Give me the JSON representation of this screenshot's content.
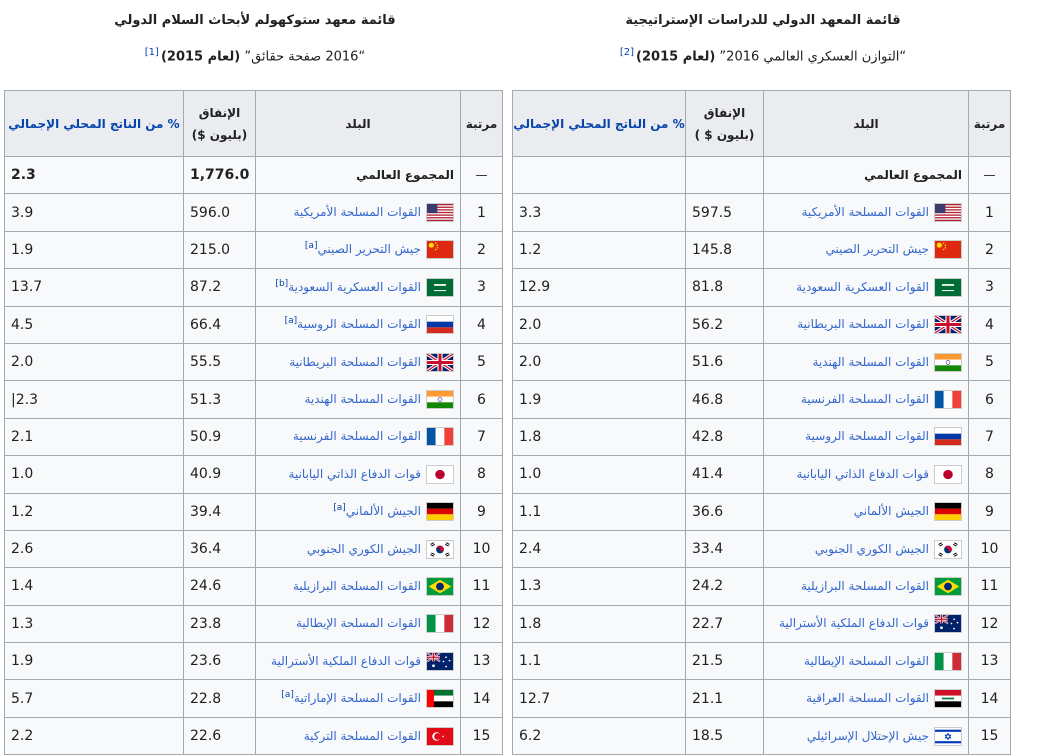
{
  "left": {
    "caption_title": "قائمة معهد ستوكهولم لأبحاث السلام الدولي",
    "caption_source": "“2016 صفحة حقائق”",
    "caption_year": "(لعام 2015)",
    "caption_ref": "[1]",
    "headers": {
      "rank": "مرتبة",
      "country": "البلد",
      "spend_1": "الإنفاق",
      "spend_2": "(بليون $)",
      "gdp": "% من الناتج المحلي الإجمالي"
    },
    "world": {
      "rank": "—",
      "country": "المجموع العالمي",
      "spend": "1,776.0",
      "gdp": "2.3"
    },
    "rows": [
      {
        "rank": "1",
        "flag": "usa",
        "country": "القوات المسلحة الأمريكية",
        "note": "",
        "spend": "596.0",
        "gdp": "3.9"
      },
      {
        "rank": "2",
        "flag": "china",
        "country": "جيش التحرير الصيني",
        "note": "[a]",
        "spend": "215.0",
        "gdp": "1.9"
      },
      {
        "rank": "3",
        "flag": "saudi",
        "country": "القوات العسكرية السعودية",
        "note": "[b]",
        "spend": "87.2",
        "gdp": "13.7"
      },
      {
        "rank": "4",
        "flag": "russia",
        "country": "القوات المسلحة الروسية",
        "note": "[a]",
        "spend": "66.4",
        "gdp": "4.5"
      },
      {
        "rank": "5",
        "flag": "uk",
        "country": "القوات المسلحة البريطانية",
        "note": "",
        "spend": "55.5",
        "gdp": "2.0"
      },
      {
        "rank": "6",
        "flag": "india",
        "country": "القوات المسلحة الهندية",
        "note": "",
        "spend": "51.3",
        "gdp": "2.3|"
      },
      {
        "rank": "7",
        "flag": "france",
        "country": "القوات المسلحة الفرنسية",
        "note": "",
        "spend": "50.9",
        "gdp": "2.1"
      },
      {
        "rank": "8",
        "flag": "japan",
        "country": "قوات الدفاع الذاتي اليابانية",
        "note": "",
        "spend": "40.9",
        "gdp": "1.0"
      },
      {
        "rank": "9",
        "flag": "germany",
        "country": "الجيش الألماني",
        "note": "[a]",
        "spend": "39.4",
        "gdp": "1.2"
      },
      {
        "rank": "10",
        "flag": "korea",
        "country": "الجيش الكوري الجنوبي",
        "note": "",
        "spend": "36.4",
        "gdp": "2.6"
      },
      {
        "rank": "11",
        "flag": "brazil",
        "country": "القوات المسلحة البرازيلية",
        "note": "",
        "spend": "24.6",
        "gdp": "1.4"
      },
      {
        "rank": "12",
        "flag": "italy",
        "country": "القوات المسلحة الإيطالية",
        "note": "",
        "spend": "23.8",
        "gdp": "1.3"
      },
      {
        "rank": "13",
        "flag": "australia",
        "country": "قوات الدفاع الملكية الأسترالية",
        "note": "",
        "spend": "23.6",
        "gdp": "1.9"
      },
      {
        "rank": "14",
        "flag": "uae",
        "country": "القوات المسلحة الإماراتية",
        "note": "[a]",
        "spend": "22.8",
        "gdp": "5.7"
      },
      {
        "rank": "15",
        "flag": "turkey",
        "country": "القوات المسلحة التركية",
        "note": "",
        "spend": "22.6",
        "gdp": "2.2"
      }
    ]
  },
  "right": {
    "caption_title": "قائمة المعهد الدولي للدراسات الإستراتيجية",
    "caption_source": "“التوازن العسكري العالمي 2016”",
    "caption_year": "(لعام 2015)",
    "caption_ref": "[2]",
    "headers": {
      "rank": "مرتبة",
      "country": "البلد",
      "spend_1": "الإنفاق",
      "spend_2": "(بليون $ )",
      "gdp": "% من الناتج المحلي الإجمالي"
    },
    "world": {
      "rank": "—",
      "country": "المجموع العالمي",
      "spend": "",
      "gdp": ""
    },
    "rows": [
      {
        "rank": "1",
        "flag": "usa",
        "country": "القوات المسلحة الأمريكية",
        "spend": "597.5",
        "gdp": "3.3"
      },
      {
        "rank": "2",
        "flag": "china",
        "country": "جيش التحرير الصيني",
        "spend": "145.8",
        "gdp": "1.2"
      },
      {
        "rank": "3",
        "flag": "saudi",
        "country": "القوات العسكرية السعودية",
        "spend": "81.8",
        "gdp": "12.9"
      },
      {
        "rank": "4",
        "flag": "uk",
        "country": "القوات المسلحة البريطانية",
        "spend": "56.2",
        "gdp": "2.0"
      },
      {
        "rank": "5",
        "flag": "india",
        "country": "القوات المسلحة الهندية",
        "spend": "51.6",
        "gdp": "2.0"
      },
      {
        "rank": "6",
        "flag": "france",
        "country": "القوات المسلحة الفرنسية",
        "spend": "46.8",
        "gdp": "1.9"
      },
      {
        "rank": "7",
        "flag": "russia",
        "country": "القوات المسلحة الروسية",
        "spend": "42.8",
        "gdp": "1.8"
      },
      {
        "rank": "8",
        "flag": "japan",
        "country": "قوات الدفاع الذاتي اليابانية",
        "spend": "41.4",
        "gdp": "1.0"
      },
      {
        "rank": "9",
        "flag": "germany",
        "country": "الجيش الألماني",
        "spend": "36.6",
        "gdp": "1.1"
      },
      {
        "rank": "10",
        "flag": "korea",
        "country": "الجيش الكوري الجنوبي",
        "spend": "33.4",
        "gdp": "2.4"
      },
      {
        "rank": "11",
        "flag": "brazil",
        "country": "القوات المسلحة البرازيلية",
        "spend": "24.2",
        "gdp": "1.3"
      },
      {
        "rank": "12",
        "flag": "australia",
        "country": "قوات الدفاع الملكية الأسترالية",
        "spend": "22.7",
        "gdp": "1.8"
      },
      {
        "rank": "13",
        "flag": "italy",
        "country": "القوات المسلحة الإيطالية",
        "spend": "21.5",
        "gdp": "1.1"
      },
      {
        "rank": "14",
        "flag": "iraq",
        "country": "القوات المسلحة العراقية",
        "spend": "21.1",
        "gdp": "12.7"
      },
      {
        "rank": "15",
        "flag": "israel",
        "country": "جيش الإحتلال الإسرائيلي",
        "spend": "18.5",
        "gdp": "6.2"
      }
    ]
  }
}
